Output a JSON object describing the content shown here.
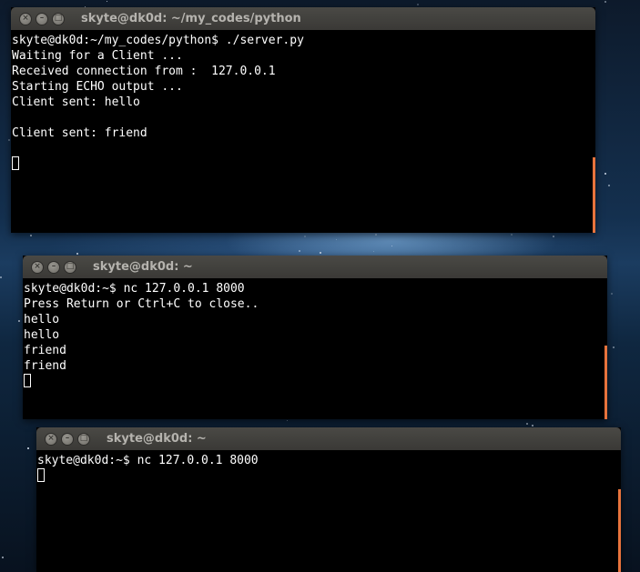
{
  "windows": [
    {
      "title": "skyte@dk0d: ~/my_codes/python",
      "lines": [
        "skyte@dk0d:~/my_codes/python$ ./server.py",
        "Waiting for a Client ...",
        "Received connection from :  127.0.0.1",
        "Starting ECHO output ...",
        "Client sent: hello",
        "",
        "Client sent: friend",
        ""
      ]
    },
    {
      "title": "skyte@dk0d: ~",
      "lines": [
        "skyte@dk0d:~$ nc 127.0.0.1 8000",
        "Press Return or Ctrl+C to close..",
        "hello",
        "hello",
        "friend",
        "friend"
      ]
    },
    {
      "title": "skyte@dk0d: ~",
      "lines": [
        "skyte@dk0d:~$ nc 127.0.0.1 8000"
      ]
    }
  ],
  "window_buttons": {
    "close": "×",
    "minimize": "–",
    "maximize": "□"
  },
  "icons": [
    "close-icon",
    "minimize-icon",
    "maximize-icon",
    "terminal-cursor-icon"
  ],
  "colors": {
    "accent_scrollbar": "#e7733c",
    "terminal_bg": "#000000",
    "terminal_fg": "#ffffff",
    "titlebar": "#3f3e3b"
  }
}
